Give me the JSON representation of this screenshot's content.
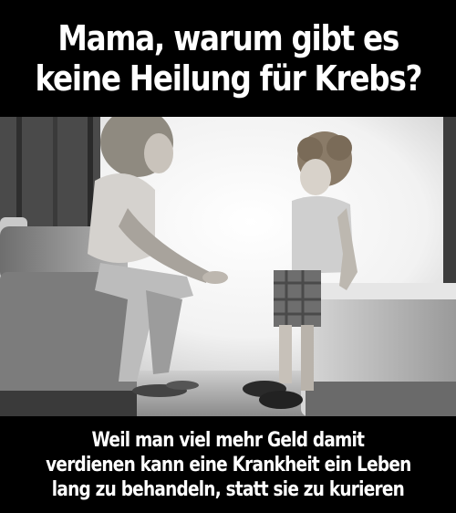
{
  "caption_top": {
    "line1": "Mama, warum gibt es",
    "line2": "keine Heilung für Krebs?"
  },
  "caption_bottom": {
    "line1": "Weil man viel mehr Geld damit",
    "line2": "verdienen kann eine Krankheit ein Leben",
    "line3": "lang zu behandeln, statt sie zu kurieren"
  },
  "colors": {
    "background": "#000000",
    "caption_text": "#ffffff"
  }
}
